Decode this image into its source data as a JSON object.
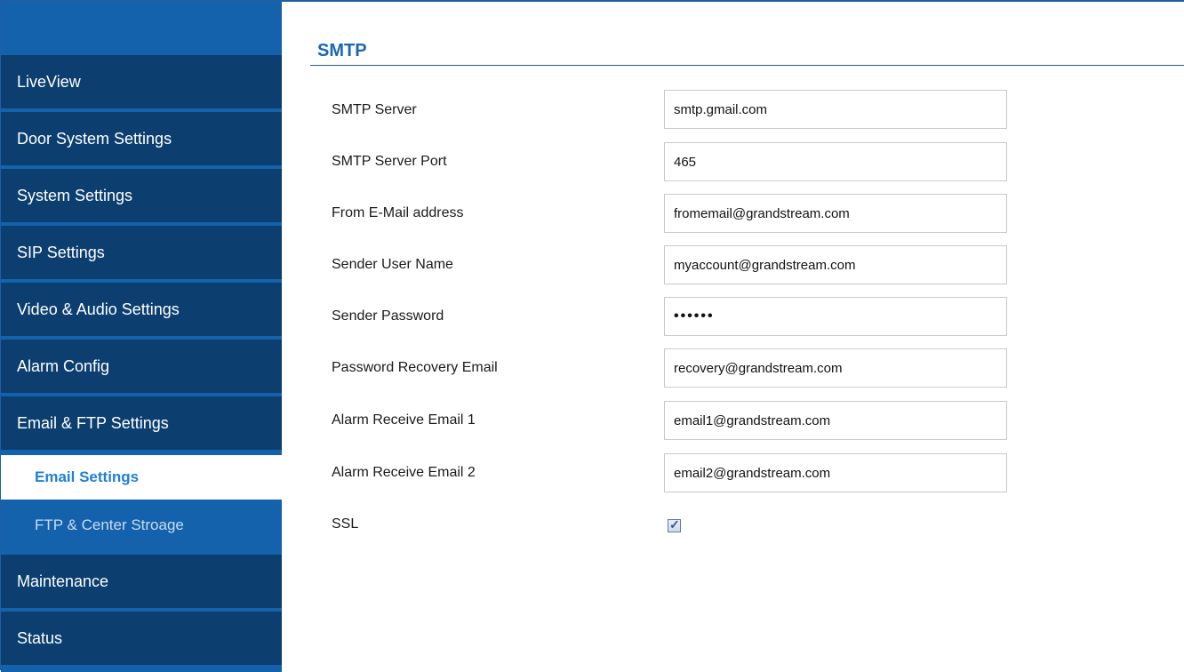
{
  "sidebar": {
    "items": [
      {
        "label": "LiveView"
      },
      {
        "label": "Door System Settings"
      },
      {
        "label": "System Settings"
      },
      {
        "label": "SIP Settings"
      },
      {
        "label": "Video & Audio Settings"
      },
      {
        "label": "Alarm Config"
      },
      {
        "label": "Email & FTP Settings"
      }
    ],
    "subitems": [
      {
        "label": "Email Settings",
        "active": true
      },
      {
        "label": "FTP & Center Stroage",
        "active": false
      }
    ],
    "bottom_items": [
      {
        "label": "Maintenance"
      },
      {
        "label": "Status"
      }
    ]
  },
  "main": {
    "section_title": "SMTP",
    "fields": [
      {
        "label": "SMTP Server",
        "value": "smtp.gmail.com"
      },
      {
        "label": "SMTP Server Port",
        "value": "465"
      },
      {
        "label": "From E-Mail address",
        "value": "fromemail@grandstream.com"
      },
      {
        "label": "Sender User Name",
        "value": "myaccount@grandstream.com"
      },
      {
        "label": "Sender Password",
        "value": "••••••"
      },
      {
        "label": "Password Recovery Email",
        "value": "recovery@grandstream.com"
      },
      {
        "label": "Alarm Receive Email 1",
        "value": "email1@grandstream.com"
      },
      {
        "label": "Alarm Receive Email 2",
        "value": "email2@grandstream.com"
      }
    ],
    "ssl": {
      "label": "SSL",
      "checked": true,
      "check_glyph": "✓"
    }
  },
  "colors": {
    "nav_dark": "#0c3f70",
    "nav_blue": "#1462ab",
    "accent": "#1a66b8",
    "active_sub_text": "#1f7fd6"
  }
}
